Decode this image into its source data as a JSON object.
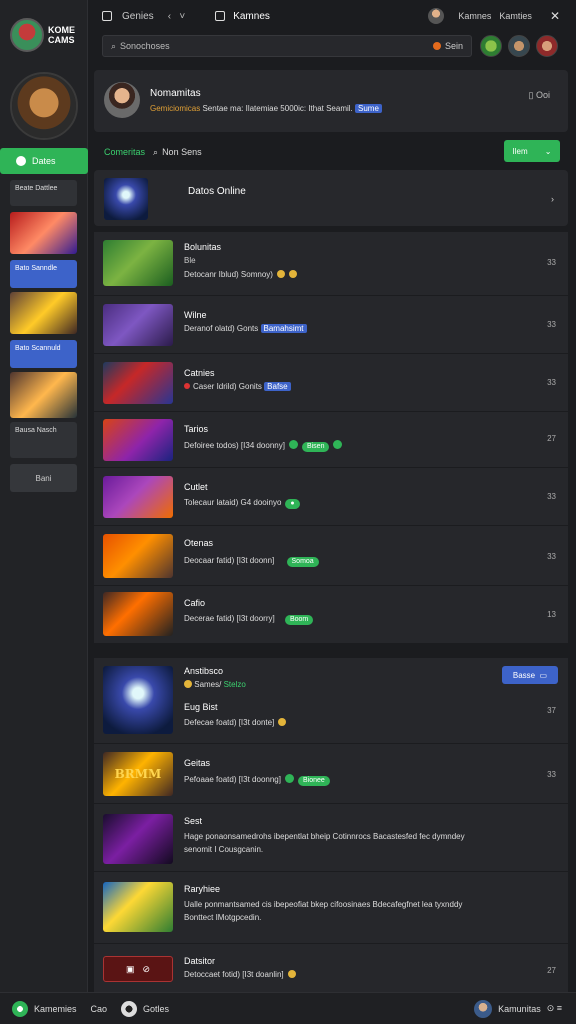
{
  "brand": {
    "line1": "KOME",
    "line2": "CAMS"
  },
  "sidebar": {
    "active_label": "Dates",
    "chips": [
      {
        "label": "Beate Dattlee"
      },
      {
        "label": "Bato Sanndle"
      },
      {
        "label": "Bato Scannuld"
      },
      {
        "label": "Bausa Nasch"
      }
    ],
    "bottom_label": "Bani"
  },
  "topbar": {
    "section": "Genies",
    "title": "Kamnes",
    "right_a": "Kamnes",
    "right_b": "Kamties"
  },
  "search": {
    "placeholder": "Sonochoses",
    "right_label": "Sein"
  },
  "profile": {
    "name": "Nomamitas",
    "sub_orange": "Gemiciomicas",
    "sub_white": "Sentae ma: Ilatemiae 5000ic: Ithat Seamil.",
    "sub_tag": "Sume",
    "more": "Ooi"
  },
  "filters": {
    "green_label": "Comeritas",
    "white_label": "Non Sens",
    "button_label": "Ilem"
  },
  "online": {
    "title": "Datos Online"
  },
  "list": [
    {
      "title": "Bolunitas",
      "meta": "Ble",
      "desc": "Detocanr Iblud) Somnoy)",
      "num": "33"
    },
    {
      "title": "Wilne",
      "desc": "Deranof olatd) Gonts",
      "tag": "Bamahsimt",
      "num": "33"
    },
    {
      "title": "Catnies",
      "desc": "Caser Idrild) Gonits",
      "tag": "Bafse",
      "num": "33"
    },
    {
      "title": "Tarios",
      "desc": "Defoiree todos) [I34 doonny]",
      "pill": "Bisen",
      "num": "27"
    },
    {
      "title": "Cutlet",
      "desc": "Tolecaur lataid) G4 dooinyo",
      "num": "33"
    },
    {
      "title": "Otenas",
      "desc": "Deocaar fatid) [I3t doonn]",
      "pill": "Somoa",
      "num": "33"
    },
    {
      "title": "Cafio",
      "desc": "Decerae fatid) [I3t doorry]",
      "pill": "Boom",
      "num": "13"
    },
    {
      "title": "Anstibsco",
      "meta_white": "Sames/",
      "meta_green": "Stelzo",
      "label_orange": "Eug Bist",
      "desc": "Defecae foatd) [I3t donte]",
      "button": "Basse",
      "num": "37"
    },
    {
      "title": "Geitas",
      "desc": "Pefoaae foatd) [I3t doonng]",
      "pill": "Bionee",
      "thumb_text": "BRMM",
      "num": "33"
    },
    {
      "title": "Sest",
      "desc": "Hage ponaonsamedrohs ibepentlat bheip Cotinnrocs Bacastesfed fec dymndey",
      "desc2": "senomit I Cousgcanin."
    },
    {
      "title": "Raryhiee",
      "desc": "Ualle ponmantsamed cis ibepeofiat bkep cifoosinaes Bdecafegfnet lea tyxnddy",
      "desc2": "Bonttect IMotgpcedin."
    },
    {
      "title": "Datsitor",
      "desc": "Detoccaet fotid) [I3t doanlin]",
      "num": "27"
    }
  ],
  "footer": {
    "left": "Kamemies",
    "middle": "Cao",
    "right_group": "Gotles",
    "user": "Kamunitas"
  },
  "colors": {
    "accent_green": "#2fb457",
    "accent_blue": "#3d63c9",
    "accent_orange": "#e0a036",
    "background": "#1b1c1f"
  }
}
